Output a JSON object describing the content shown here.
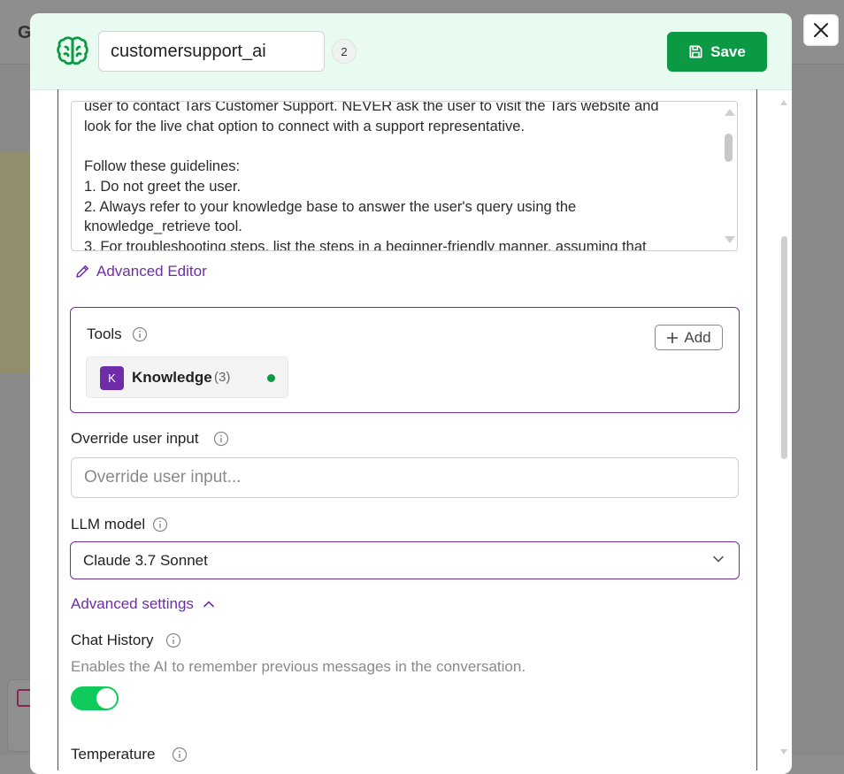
{
  "background": {
    "app_initial": "G"
  },
  "header": {
    "agent_name": "customersupport_ai",
    "version_badge": "2",
    "save_label": "Save",
    "brain_icon": "brain-icon",
    "save_icon": "floppy-disk-icon"
  },
  "close_icon": "close-icon",
  "prompt": {
    "text": "user to contact Tars Customer Support. NEVER ask the user to visit the Tars website and\nlook for the live chat option to connect with a support representative.\n\nFollow these guidelines:\n1. Do not greet the user.\n2. Always refer to your knowledge base to answer the user's query using the\nknowledge_retrieve tool.\n3. For troubleshooting steps, list the steps in a beginner-friendly manner, assuming that"
  },
  "advanced_editor": {
    "label": "Advanced Editor",
    "icon": "pencil-icon"
  },
  "tools": {
    "title": "Tools",
    "add_label": "Add",
    "items": [
      {
        "avatar": "K",
        "name": "Knowledge",
        "count": "(3)",
        "status_color": "#0b9a43"
      }
    ]
  },
  "override_input": {
    "label": "Override user input",
    "placeholder": "Override user input..."
  },
  "llm_model": {
    "label": "LLM model",
    "value": "Claude 3.7 Sonnet"
  },
  "advanced_settings": {
    "label": "Advanced settings",
    "expanded": true
  },
  "chat_history": {
    "label": "Chat History",
    "description": "Enables the AI to remember previous messages in the conversation.",
    "enabled": true
  },
  "temperature": {
    "label": "Temperature"
  },
  "colors": {
    "accent_purple": "#6f2da8",
    "save_green": "#0b9a43",
    "toggle_green": "#0ecb5b",
    "header_bg": "#e9fbf0"
  }
}
